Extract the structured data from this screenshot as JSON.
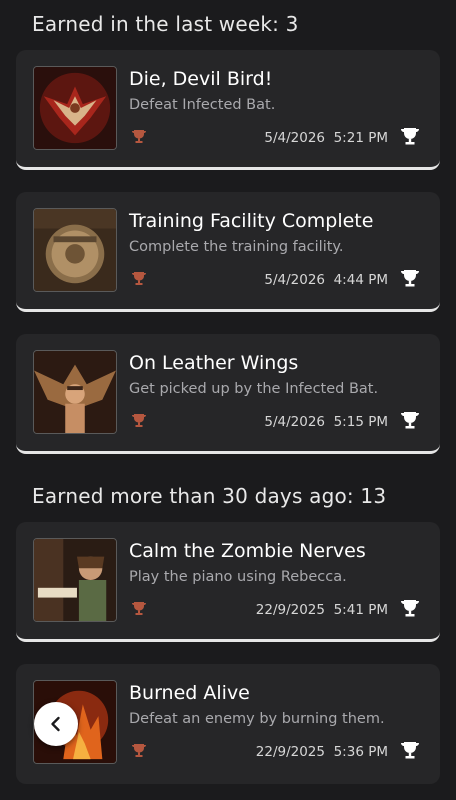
{
  "sections": [
    {
      "title": "Earned in the last week: 3"
    },
    {
      "title": "Earned more than 30 days ago: 13"
    }
  ],
  "trophies": [
    {
      "title": "Die, Devil Bird!",
      "description": "Defeat Infected Bat.",
      "date": "5/4/2026",
      "time": "5:21 PM",
      "grade": "bronze",
      "thumb_icon": "devil-bird-thumbnail"
    },
    {
      "title": "Training Facility Complete",
      "description": "Complete the training facility.",
      "date": "5/4/2026",
      "time": "4:44 PM",
      "grade": "bronze",
      "thumb_icon": "training-facility-thumbnail"
    },
    {
      "title": "On Leather Wings",
      "description": "Get picked up by the Infected Bat.",
      "date": "5/4/2026",
      "time": "5:15 PM",
      "grade": "bronze",
      "thumb_icon": "leather-wings-thumbnail"
    },
    {
      "title": "Calm the Zombie Nerves",
      "description": "Play the piano using Rebecca.",
      "date": "22/9/2025",
      "time": "5:41 PM",
      "grade": "bronze",
      "thumb_icon": "zombie-nerves-thumbnail"
    },
    {
      "title": "Burned Alive",
      "description": "Defeat an enemy by burning them.",
      "date": "22/9/2025",
      "time": "5:36 PM",
      "grade": "bronze",
      "thumb_icon": "burned-alive-thumbnail"
    }
  ],
  "colors": {
    "background": "#1b1b1d",
    "card": "#262628",
    "bronze": "#b5573f",
    "muted_text": "#a9a9ad"
  },
  "icons": {
    "grade": "bronze-trophy-icon",
    "earned": "earned-trophy-icon",
    "back": "chevron-left-icon"
  }
}
